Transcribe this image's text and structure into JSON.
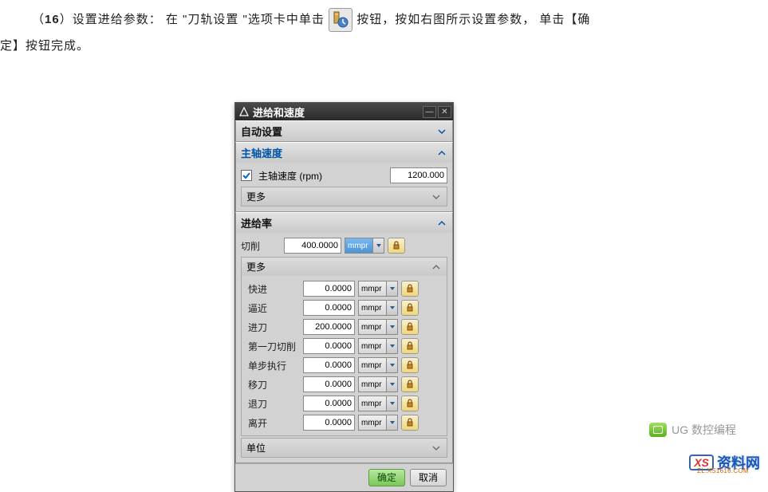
{
  "instruction": {
    "prefix": "（",
    "num": "16",
    "text1": "）设置进给参数：  在 \"刀轨设置 \"选项卡中单击 ",
    "text2": " 按钮，按如右图所示设置参数，   单击【确",
    "text3": "定】按钮完成。"
  },
  "dialog": {
    "title": "进给和速度",
    "sections": {
      "auto": "自动设置",
      "spindle": "主轴速度",
      "feedrate": "进给率",
      "unit": "单位"
    },
    "spindle": {
      "rpm_label": "主轴速度 (rpm)",
      "rpm_value": "1200.000",
      "more": "更多"
    },
    "feed": {
      "cut_label": "切削",
      "cut_value": "400.0000",
      "cut_unit": "mmpr",
      "more": "更多",
      "rows": [
        {
          "label": "快进",
          "value": "0.0000",
          "unit": "mmpr"
        },
        {
          "label": "逼近",
          "value": "0.0000",
          "unit": "mmpr"
        },
        {
          "label": "进刀",
          "value": "200.0000",
          "unit": "mmpr"
        },
        {
          "label": "第一刀切削",
          "value": "0.0000",
          "unit": "mmpr"
        },
        {
          "label": "单步执行",
          "value": "0.0000",
          "unit": "mmpr"
        },
        {
          "label": "移刀",
          "value": "0.0000",
          "unit": "mmpr"
        },
        {
          "label": "退刀",
          "value": "0.0000",
          "unit": "mmpr"
        },
        {
          "label": "离开",
          "value": "0.0000",
          "unit": "mmpr"
        }
      ]
    },
    "buttons": {
      "ok": "确定",
      "cancel": "取消"
    }
  },
  "watermark": {
    "wm1": "UG 数控编程",
    "wm2_badge": "XS",
    "wm2_text": "资料网",
    "wm2_sub": "ZL.XS1616.COM"
  }
}
